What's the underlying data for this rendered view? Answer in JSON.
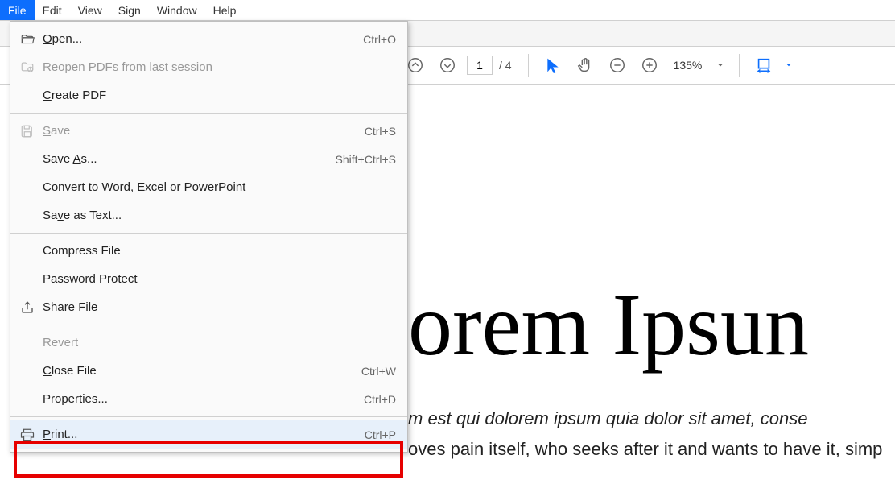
{
  "menubar": {
    "items": [
      {
        "label": "File",
        "active": true
      },
      {
        "label": "Edit"
      },
      {
        "label": "View"
      },
      {
        "label": "Sign"
      },
      {
        "label": "Window"
      },
      {
        "label": "Help"
      }
    ]
  },
  "toolbar": {
    "page_current": "1",
    "page_total": "/ 4",
    "zoom_value": "135%"
  },
  "dropdown": {
    "open": {
      "label_pre": "",
      "u": "O",
      "label_post": "pen...",
      "shortcut": "Ctrl+O",
      "icon": "folder"
    },
    "reopen": {
      "label": "Reopen PDFs from last session",
      "disabled": true,
      "icon": "folder-clock"
    },
    "createpdf": {
      "label_pre": "",
      "u": "C",
      "label_post": "reate PDF"
    },
    "save": {
      "label_pre": "",
      "u": "S",
      "label_post": "ave",
      "shortcut": "Ctrl+S",
      "disabled": true,
      "icon": "floppy"
    },
    "saveas": {
      "label_pre": "Save ",
      "u": "A",
      "label_post": "s...",
      "shortcut": "Shift+Ctrl+S"
    },
    "convert": {
      "label_pre": "Convert to Wo",
      "u": "r",
      "label_post": "d, Excel or PowerPoint"
    },
    "savetext": {
      "label_pre": "Sa",
      "u": "v",
      "label_post": "e as Text..."
    },
    "compress": {
      "label": "Compress File"
    },
    "password": {
      "label": "Password Protect"
    },
    "share": {
      "label": "Share File",
      "icon": "share"
    },
    "revert": {
      "label": "Revert",
      "disabled": true
    },
    "close": {
      "label_pre": "",
      "u": "C",
      "label_post": "lose File",
      "shortcut": "Ctrl+W"
    },
    "properties": {
      "label": "Properties...",
      "shortcut": "Ctrl+D"
    },
    "print": {
      "label_pre": "",
      "u": "P",
      "label_post": "rint...",
      "shortcut": "Ctrl+P",
      "icon": "print",
      "highlighted": true
    }
  },
  "document": {
    "title": "orem Ipsun",
    "p1": "m est qui dolorem ipsum quia dolor sit amet, conse",
    "p2": "oves pain itself, who seeks after it and wants to have it, simp"
  }
}
